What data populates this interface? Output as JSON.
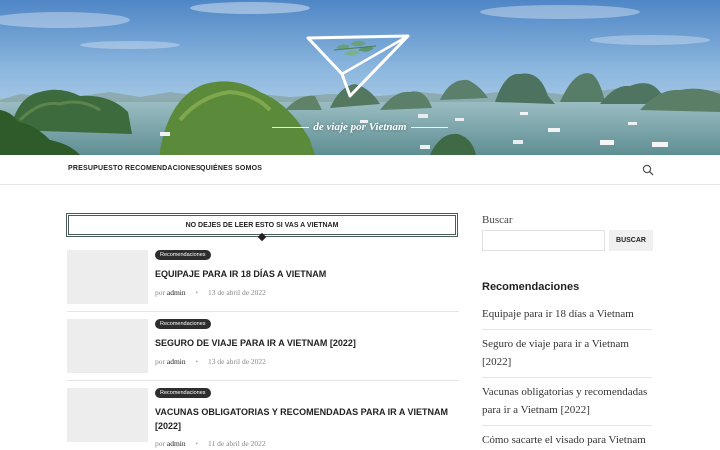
{
  "site": {
    "tagline": "de viaje por Vietnam"
  },
  "nav": {
    "items": [
      {
        "label": "PRESUPUESTO"
      },
      {
        "label": "RECOMENDACIONES"
      },
      {
        "label": "QUIÉNES SOMOS"
      }
    ]
  },
  "main": {
    "section_title": "NO DEJES DE LEER ESTO SI VAS A VIETNAM",
    "posts": [
      {
        "category": "Recomendaciones",
        "title": "EQUIPAJE PARA IR 18 DÍAS A VIETNAM",
        "by": "por",
        "author": "admin",
        "date": "13 de abril de 2022"
      },
      {
        "category": "Recomendaciones",
        "title": "SEGURO DE VIAJE PARA IR A VIETNAM [2022]",
        "by": "por",
        "author": "admin",
        "date": "13 de abril de 2022"
      },
      {
        "category": "Recomendaciones",
        "title": "VACUNAS OBLIGATORIAS Y RECOMENDADAS PARA IR A VIETNAM [2022]",
        "by": "por",
        "author": "admin",
        "date": "11 de abril de 2022"
      }
    ]
  },
  "sidebar": {
    "search_label": "Buscar",
    "search_value": "",
    "search_button": "BUSCAR",
    "heading": "Recomendaciones",
    "links": [
      {
        "label": "Equipaje para ir 18 días a Vietnam"
      },
      {
        "label": "Seguro de viaje para ir a Vietnam [2022]"
      },
      {
        "label": "Vacunas obligatorias y recomendadas para ir a Vietnam [2022]"
      },
      {
        "label": "Cómo sacarte el visado para Vietnam"
      }
    ]
  },
  "icons": {
    "search": "search-icon",
    "logo": "paper-plane-logo"
  },
  "colors": {
    "accent_dark": "#2d2d2d",
    "section_border": "#4a5d5a",
    "logo_leaf": "#6aa07a"
  }
}
